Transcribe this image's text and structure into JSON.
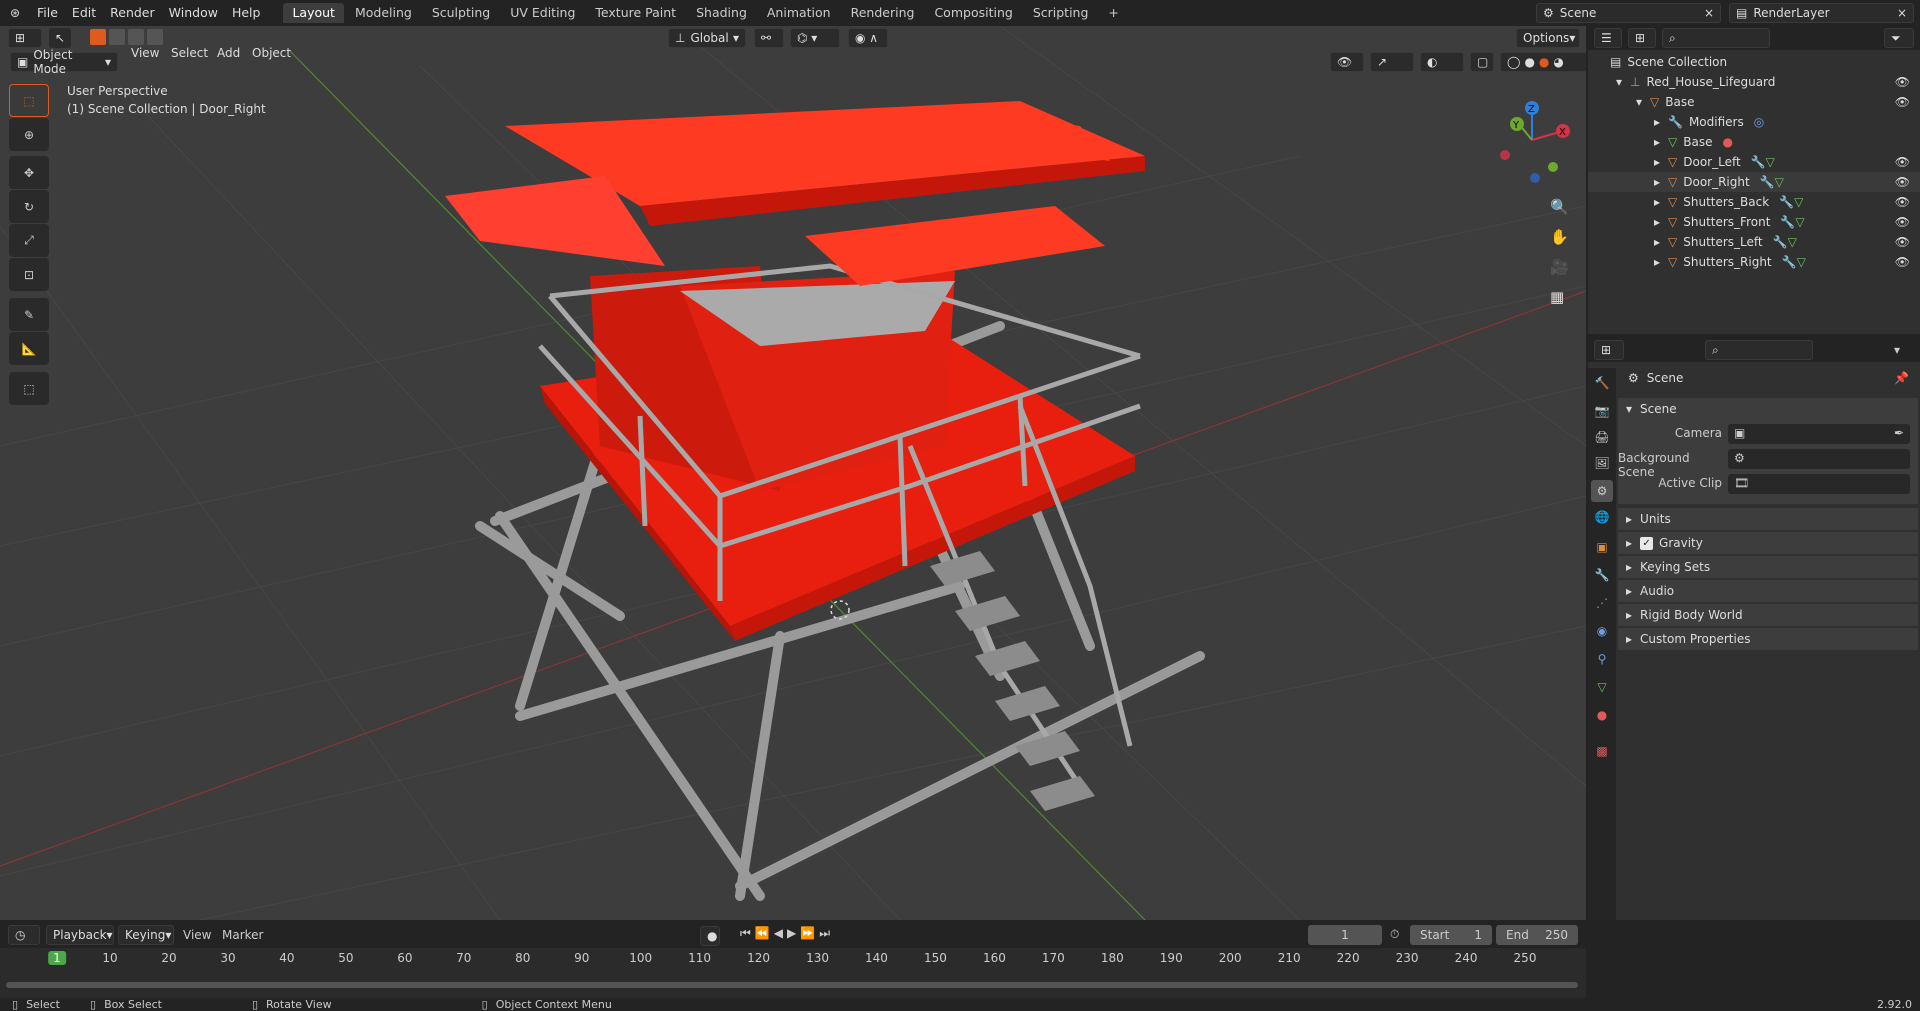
{
  "menu": [
    "File",
    "Edit",
    "Render",
    "Window",
    "Help"
  ],
  "workspaces": [
    "Layout",
    "Modeling",
    "Sculpting",
    "UV Editing",
    "Texture Paint",
    "Shading",
    "Animation",
    "Rendering",
    "Compositing",
    "Scripting"
  ],
  "top_right": {
    "scene": "Scene",
    "render_layer": "RenderLayer"
  },
  "viewport": {
    "mode": "Object Mode",
    "menus": [
      "View",
      "Select",
      "Add",
      "Object"
    ],
    "orientation": "Global",
    "options": "Options",
    "perspective": "User Perspective",
    "collection": "(1) Scene Collection | Door_Right",
    "gizmo": {
      "x": "X",
      "y": "Y",
      "z": "Z"
    }
  },
  "outliner": {
    "root": "Scene Collection",
    "items": [
      {
        "label": "Red_House_Lifeguard",
        "depth": 1
      },
      {
        "label": "Base",
        "depth": 2
      },
      {
        "label": "Modifiers",
        "depth": 3
      },
      {
        "label": "Base",
        "depth": 3
      },
      {
        "label": "Door_Left",
        "depth": 3
      },
      {
        "label": "Door_Right",
        "depth": 3
      },
      {
        "label": "Shutters_Back",
        "depth": 3
      },
      {
        "label": "Shutters_Front",
        "depth": 3
      },
      {
        "label": "Shutters_Left",
        "depth": 3
      },
      {
        "label": "Shutters_Right",
        "depth": 3
      }
    ]
  },
  "properties": {
    "header": "Scene",
    "section": "Scene",
    "fields": [
      "Camera",
      "Background Scene",
      "Active Clip"
    ],
    "panels": [
      "Units",
      "Gravity",
      "Keying Sets",
      "Audio",
      "Rigid Body World",
      "Custom Properties"
    ]
  },
  "timeline": {
    "menus": [
      "Playback",
      "Keying",
      "View",
      "Marker"
    ],
    "current": "1",
    "start_label": "Start",
    "start": "1",
    "end_label": "End",
    "end": "250",
    "ticks": [
      "1",
      "10",
      "20",
      "30",
      "40",
      "50",
      "60",
      "70",
      "80",
      "90",
      "100",
      "110",
      "120",
      "130",
      "140",
      "150",
      "160",
      "170",
      "180",
      "190",
      "200",
      "210",
      "220",
      "230",
      "240",
      "250"
    ]
  },
  "status": {
    "select": "Select",
    "box_select": "Box Select",
    "rotate": "Rotate View",
    "context": "Object Context Menu",
    "version": "2.92.0"
  },
  "colors": {
    "accent": "#e05a1f",
    "selected": "#4772b3",
    "red": "#ff2410"
  }
}
